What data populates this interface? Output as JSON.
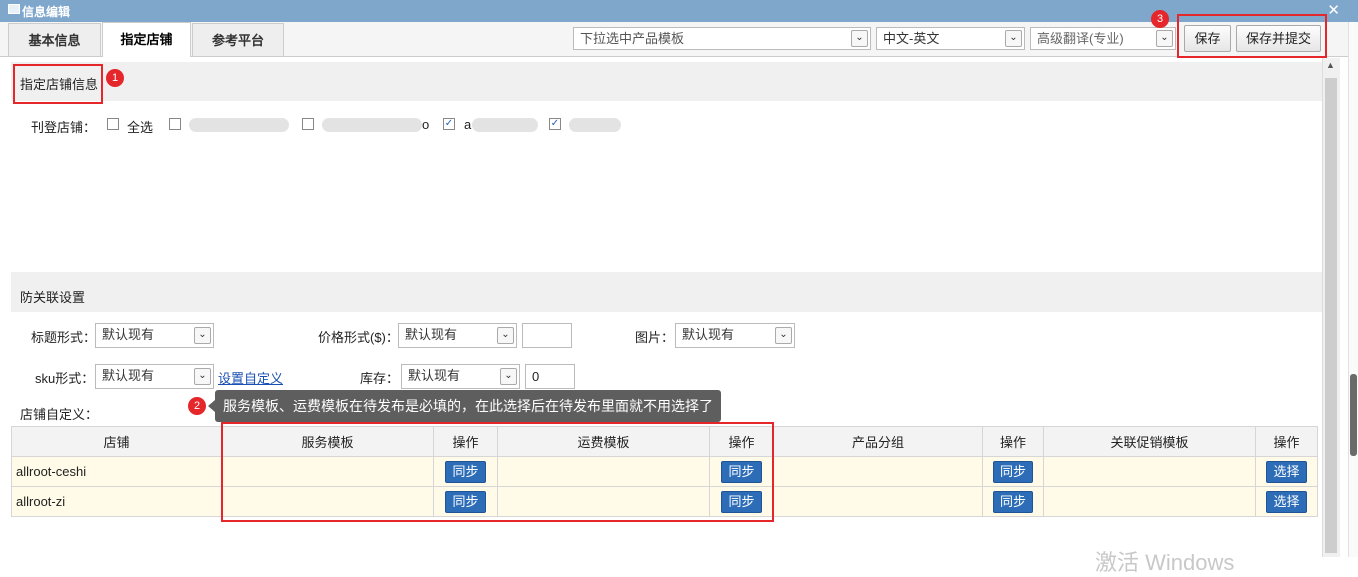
{
  "window": {
    "title": "信息编辑",
    "close_icon": "close-icon"
  },
  "tabs": [
    {
      "label": "基本信息",
      "active": false
    },
    {
      "label": "指定店铺",
      "active": true
    },
    {
      "label": "参考平台",
      "active": false
    }
  ],
  "toolbar": {
    "product_template_placeholder": "下拉选中产品模板",
    "language": "中文-英文",
    "translation": "高级翻译(专业)",
    "save_label": "保存",
    "save_submit_label": "保存并提交"
  },
  "annotations": {
    "badge1": "1",
    "badge2": "2",
    "badge3": "3"
  },
  "shop_section": {
    "title": "指定店铺信息",
    "publish_label": "刊登店铺：",
    "select_all_label": "全选",
    "shops": [
      {
        "label": "",
        "checked": false,
        "suffix": ""
      },
      {
        "label": "",
        "checked": false,
        "suffix": "o"
      },
      {
        "label": "",
        "checked": true,
        "suffix": "a"
      },
      {
        "label": "",
        "checked": true,
        "suffix": ""
      }
    ]
  },
  "anti_assoc": {
    "title": "防关联设置",
    "title_format_label": "标题形式：",
    "title_format_value": "默认现有",
    "price_format_label": "价格形式($)：",
    "price_format_value": "默认现有",
    "price_input": "",
    "image_label": "图片：",
    "image_value": "默认现有",
    "sku_label": "sku形式：",
    "sku_value": "默认现有",
    "custom_link": "设置自定义",
    "stock_label": "库存：",
    "stock_value": "默认现有",
    "stock_input": "0",
    "shop_custom_label": "店铺自定义："
  },
  "tooltip": "服务模板、运费模板在待发布是必填的，在此选择后在待发布里面就不用选择了",
  "table": {
    "headers": [
      "店铺",
      "服务模板",
      "操作",
      "运费模板",
      "操作",
      "产品分组",
      "操作",
      "关联促销模板",
      "操作"
    ],
    "rows": [
      {
        "shop": "allroot-ceshi",
        "sync1": "同步",
        "sync2": "同步",
        "sync3": "同步",
        "choose": "选择"
      },
      {
        "shop": "allroot-zi",
        "sync1": "同步",
        "sync2": "同步",
        "sync3": "同步",
        "choose": "选择"
      }
    ]
  },
  "watermark": "激活 Windows"
}
